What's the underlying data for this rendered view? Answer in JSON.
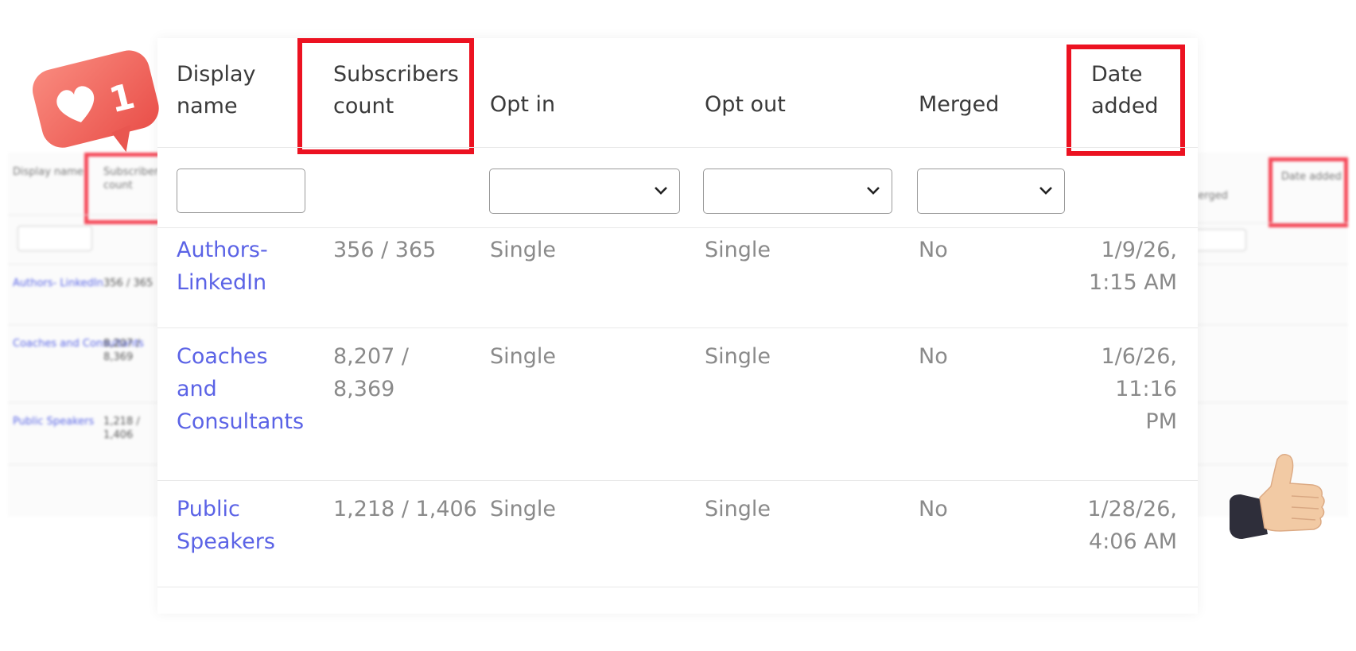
{
  "columns": {
    "display_name": "Display\nname",
    "subscribers_count": "Subscribers\ncount",
    "opt_in": "Opt in",
    "opt_out": "Opt out",
    "merged": "Merged",
    "date_added": "Date\nadded"
  },
  "filters": {
    "display_name_value": "",
    "opt_in_value": "",
    "opt_out_value": "",
    "merged_value": ""
  },
  "rows": [
    {
      "name": "Authors-\nLinkedIn",
      "subscribers": "356 / 365",
      "opt_in": "Single",
      "opt_out": "Single",
      "merged": "No",
      "date": "1/9/26,\n1:15 AM"
    },
    {
      "name": "Coaches\nand\nConsultants",
      "subscribers": "8,207 /\n8,369",
      "opt_in": "Single",
      "opt_out": "Single",
      "merged": "No",
      "date": "1/6/26,\n11:16 PM"
    },
    {
      "name": "Public\nSpeakers",
      "subscribers": "1,218 / 1,406",
      "opt_in": "Single",
      "opt_out": "Single",
      "merged": "No",
      "date": "1/28/26,\n4:06 AM"
    }
  ],
  "badge": {
    "count": "1",
    "icon": "heart-icon"
  },
  "decor": {
    "thumb_icon": "thumbs-up-icon"
  },
  "colors": {
    "highlight": "#ec1221",
    "link": "#5b63e6",
    "badge": "#f2665f"
  }
}
